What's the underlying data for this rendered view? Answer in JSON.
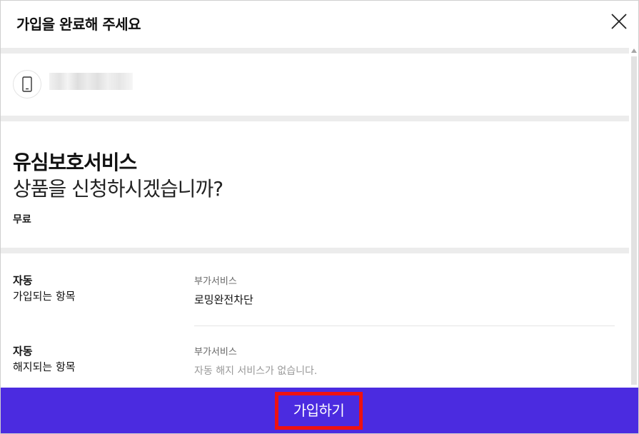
{
  "header": {
    "title": "가입을 완료해 주세요",
    "close_icon": "close-icon"
  },
  "phone": {
    "icon": "smartphone-icon"
  },
  "service": {
    "name": "유심보호서비스",
    "question": "상품을 신청하시겠습니까?",
    "price": "무료"
  },
  "auto_join": {
    "label_line1": "자동",
    "label_line2": "가입되는 항목",
    "category": "부가서비스",
    "value": "로밍완전차단"
  },
  "auto_cancel": {
    "label_line1": "자동",
    "label_line2": "해지되는 항목",
    "category": "부가서비스",
    "value": "자동 해지 서비스가 없습니다."
  },
  "footer": {
    "join_label": "가입하기"
  },
  "colors": {
    "accent": "#4b2be0",
    "highlight_border": "#ee1111",
    "divider": "#ececec"
  }
}
